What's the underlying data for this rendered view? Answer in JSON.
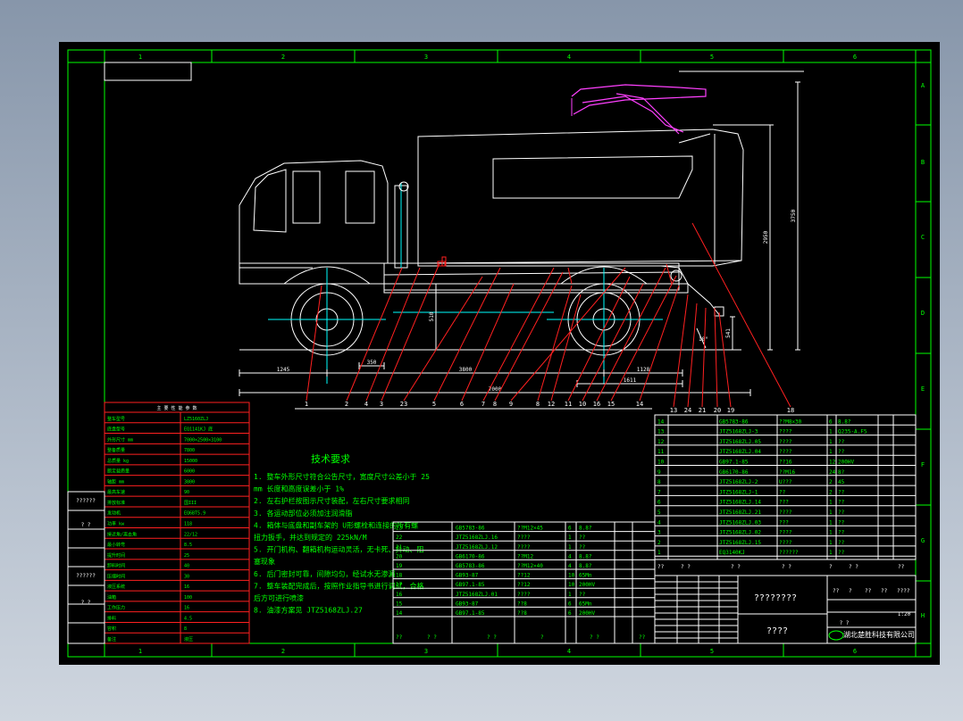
{
  "colors": {
    "frame": "#00ff00",
    "drawing": "#ffffff",
    "cyan": "#00ffff",
    "red": "#ff2020",
    "magenta": "#ff40ff",
    "dim": "#ffffff"
  },
  "border": {
    "cols": [
      "1",
      "2",
      "3",
      "4",
      "5",
      "6"
    ],
    "rows": [
      "A",
      "B",
      "C",
      "D",
      "E",
      "F",
      "G",
      "H"
    ]
  },
  "dims": {
    "d1245": "1245",
    "d3800": "3800",
    "d7000": "7000",
    "d1128": "1128",
    "d1611": "1611",
    "d510": "510",
    "d350": "350",
    "d541": "541",
    "d2950": "2950",
    "d3750": "3750",
    "d18": "18°"
  },
  "balloons": [
    "1",
    "2",
    "4",
    "3",
    "23",
    "5",
    "6",
    "7",
    "8",
    "9",
    "8",
    "12",
    "11",
    "10",
    "16",
    "15",
    "14",
    "13",
    "24",
    "21",
    "20",
    "19",
    "18",
    "17",
    "22"
  ],
  "specs": {
    "header": "主 要 性 能 参 数",
    "rows": [
      [
        "整车型号",
        "LZ5160ZLJ"
      ],
      [
        "底盘型号",
        "EQ1141KJ 底"
      ],
      [
        "外形尺寸 mm",
        "7000×2500×3100"
      ],
      [
        "整备质量",
        "7800"
      ],
      [
        "总质量 kg",
        "15000"
      ],
      [
        "额定载质量",
        "6000"
      ],
      [
        "轴距 mm",
        "3800"
      ],
      [
        "最高车速",
        "90"
      ],
      [
        "排放标准",
        "国III"
      ],
      [
        "发动机",
        "EQ6BT5.9"
      ],
      [
        "功率 kw",
        "118"
      ],
      [
        "接近角/离去角",
        "22/12"
      ],
      [
        "最小转弯",
        "8.5"
      ],
      [
        "提升时间",
        "25"
      ],
      [
        "卸料时间",
        "40"
      ],
      [
        "压缩时间",
        "30"
      ],
      [
        "液压系统",
        "16"
      ],
      [
        "油箱",
        "100"
      ],
      [
        "工作压力",
        "16"
      ],
      [
        "排料",
        "4.5"
      ],
      [
        "容积",
        "8"
      ],
      [
        "备注",
        "液压"
      ]
    ]
  },
  "left_labels": [
    "??????",
    "? ?",
    "??????",
    "? ?"
  ],
  "tech": {
    "title": "技术要求",
    "lines": [
      "1. 整车外形尺寸符合公告尺寸，宽度尺寸公差小于 25",
      "   mm  长度和高度误差小于 1%",
      "2. 左右护栏按图示尺寸装配，左右尺寸要求相同",
      "3. 各运动部位必须加注润滑脂",
      "4. 箱体与底盘和副车架的 U形螺栓和连接的所有螺",
      "   扭力扳手，并达到规定的 225kN/M",
      "5. 开门机构、翻箱机构运动灵活，无卡死、抖动、阻",
      "   塞现象",
      "6. 后门密封可靠，间隙均匀，经试水无渗漏",
      "7. 整车装配完成后，按照作业指导书进行调试，合格",
      "   后方可进行喷漆",
      "8. 油漆方案见 JTZ5168ZLJ.27"
    ]
  },
  "parts_right": {
    "rows": [
      [
        "14",
        "GB5783-86",
        "??M8×30",
        "6",
        "8.8?"
      ],
      [
        "13",
        "JTZ5168ZLJ-3",
        "????",
        "1",
        "Q235-A.F5"
      ],
      [
        "12",
        "JTZ5168ZLJ.05",
        "????",
        "1",
        "??"
      ],
      [
        "11",
        "JTZ5168ZLJ.04",
        "????",
        "1",
        "??"
      ],
      [
        "10",
        "GB97.1-85",
        "??16",
        "12",
        "200HV"
      ],
      [
        "9",
        "GB6170-86",
        "??M16",
        "24",
        "8?"
      ],
      [
        "8",
        "JTZ5168ZLJ-2",
        "U???",
        "2",
        "45"
      ],
      [
        "7",
        "JTZ5168ZLJ-1",
        "??",
        "2",
        "??"
      ],
      [
        "6",
        "JTZ5168ZLJ.14",
        "???",
        "1",
        "??"
      ],
      [
        "5",
        "JTZ5168ZLJ.21",
        "????",
        "1",
        "??"
      ],
      [
        "4",
        "JTZ5168ZLJ.03",
        "???",
        "1",
        "??"
      ],
      [
        "3",
        "JTZ5168ZLJ.02",
        "????",
        "1",
        "??"
      ],
      [
        "2",
        "JTZ5168ZLJ.15",
        "????",
        "1",
        "??"
      ],
      [
        "1",
        "EQ3140KJ",
        "??????",
        "1",
        "??"
      ]
    ],
    "header": [
      "??",
      "?  ?",
      "?  ?",
      "?  ?",
      "?",
      "?  ?",
      "??"
    ]
  },
  "parts_left": {
    "rows": [
      [
        "23",
        "GB5783-86",
        "??M12×45",
        "6",
        "8.8?"
      ],
      [
        "22",
        "JTZ5168ZLJ.16",
        "????",
        "1",
        "??"
      ],
      [
        "21",
        "JTZ5168ZLJ.12",
        "????",
        "1",
        "??"
      ],
      [
        "20",
        "GB6170-86",
        "??M12",
        "4",
        "8.8?"
      ],
      [
        "19",
        "GB5783-86",
        "??M12×40",
        "4",
        "8.8?"
      ],
      [
        "18",
        "GB93-87",
        "??12",
        "10",
        "65Mn"
      ],
      [
        "17",
        "GB97.1-85",
        "??12",
        "10",
        "200HV"
      ],
      [
        "16",
        "JTZ5168ZLJ.01",
        "????",
        "1",
        "??"
      ],
      [
        "15",
        "GB93-87",
        "??8",
        "6",
        "65Mn"
      ],
      [
        "14",
        "GB97.1-85",
        "??8",
        "6",
        "200HV"
      ]
    ],
    "header": [
      "??",
      "?  ?",
      "?  ?",
      "?",
      "?  ?",
      "??"
    ]
  },
  "title_block": {
    "name": "????????",
    "drawing": "????",
    "company": "湖北楚胜科技有限公司",
    "scale": "1:20",
    "sheet": "? ?",
    "marks": [
      "??",
      "?",
      "??",
      "??",
      "????"
    ]
  }
}
